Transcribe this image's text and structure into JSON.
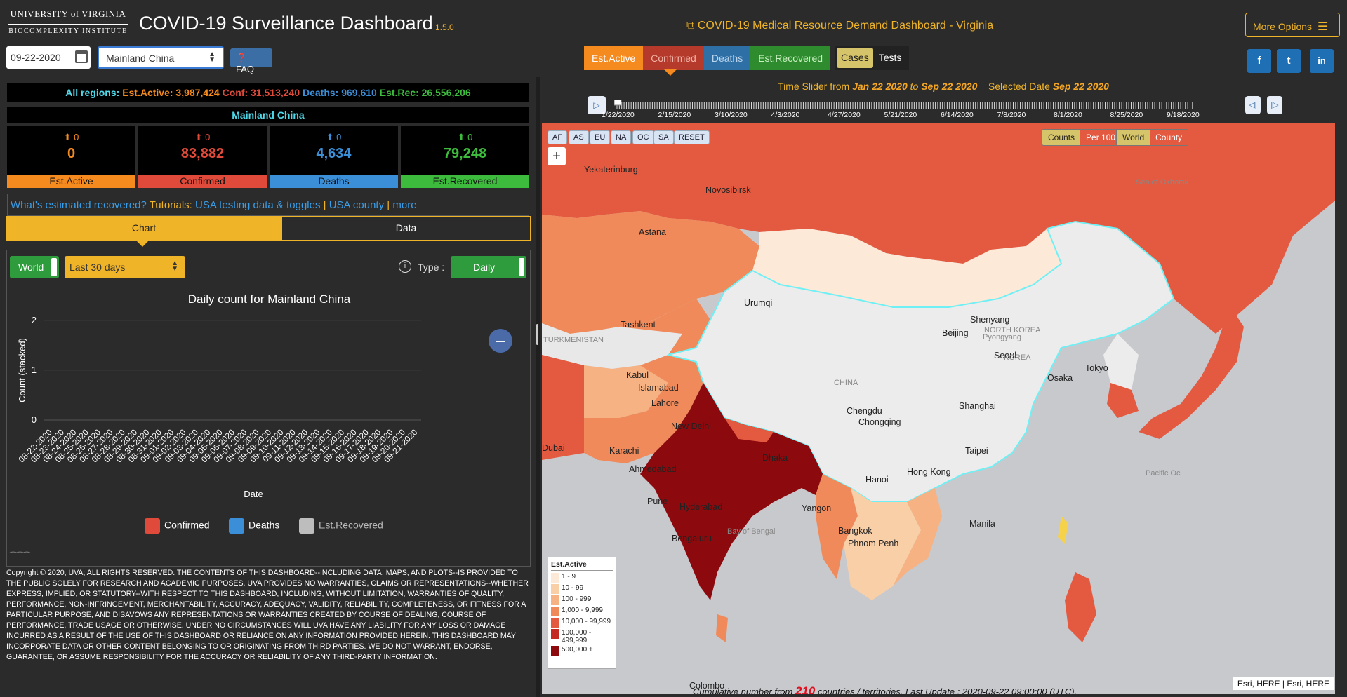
{
  "header": {
    "logo_uva": "UNIVERSITY of VIRGINIA",
    "logo_bio": "BIOCOMPLEXITY INSTITUTE",
    "title": "COVID-19 Surveillance Dashboard",
    "version": "1.5.0",
    "date_value": "09-22-2020",
    "region_value": "Mainland China",
    "faq_label": "FAQ",
    "medical_link": "COVID-19 Medical Resource Demand Dashboard - Virginia",
    "more_options": "More Options",
    "social": [
      "f",
      "t",
      "in"
    ]
  },
  "metric_tabs": [
    {
      "label": "Est.Active",
      "color": "#f58a1f"
    },
    {
      "label": "Confirmed",
      "color": "#b53a2c"
    },
    {
      "label": "Deaths",
      "color": "#2e6fa5"
    },
    {
      "label": "Est.Recovered",
      "color": "#2e8c2e"
    },
    {
      "label": "Cases",
      "color": "#d6c46a"
    },
    {
      "label": "Tests",
      "color": "#222"
    }
  ],
  "summary": {
    "prefix": "All regions:",
    "est_active": "Est.Active: 3,987,424",
    "conf": "Conf: 31,513,240",
    "deaths": "Deaths: 969,610",
    "est_rec": "Est.Rec: 26,556,206"
  },
  "region_head": "Mainland China",
  "stats": [
    {
      "change": "0",
      "value": "0",
      "label": "Est.Active",
      "color": "#f58a1f",
      "bg": "#f58a1f"
    },
    {
      "change": "0",
      "value": "83,882",
      "label": "Confirmed",
      "color": "#e04a3a",
      "bg": "#e04a3a"
    },
    {
      "change": "0",
      "value": "4,634",
      "label": "Deaths",
      "color": "#3a8fd8",
      "bg": "#3a8fd8"
    },
    {
      "change": "0",
      "value": "79,248",
      "label": "Est.Recovered",
      "color": "#3dbb3d",
      "bg": "#3dbb3d"
    }
  ],
  "links": {
    "q": "What's estimated recovered?",
    "tut": "Tutorials:",
    "l1": "USA testing data & toggles",
    "l2": "USA county",
    "l3": "more",
    "sep": "|"
  },
  "view_tabs": {
    "chart": "Chart",
    "data": "Data"
  },
  "chart_controls": {
    "scope": "World",
    "period": "Last 30 days",
    "type_label": "Type :",
    "type_value": "Daily"
  },
  "chart_data": {
    "type": "bar",
    "title": "Daily count for Mainland China",
    "xlabel": "Date",
    "ylabel": "Count (stacked)",
    "ylim": [
      0,
      2
    ],
    "yticks": [
      "2",
      "1",
      "0"
    ],
    "categories": [
      "08-22-2020",
      "08-23-2020",
      "08-24-2020",
      "08-25-2020",
      "08-26-2020",
      "08-27-2020",
      "08-28-2020",
      "08-29-2020",
      "08-30-2020",
      "08-31-2020",
      "09-01-2020",
      "09-02-2020",
      "09-03-2020",
      "09-04-2020",
      "09-05-2020",
      "09-06-2020",
      "09-07-2020",
      "09-08-2020",
      "09-09-2020",
      "09-10-2020",
      "09-11-2020",
      "09-12-2020",
      "09-13-2020",
      "09-14-2020",
      "09-15-2020",
      "09-16-2020",
      "09-17-2020",
      "09-18-2020",
      "09-19-2020",
      "09-20-2020",
      "09-21-2020"
    ],
    "series": [
      {
        "name": "Confirmed",
        "color": "#e04a3a",
        "values": [
          0,
          0,
          0,
          0,
          0,
          0,
          0,
          0,
          0,
          0,
          0,
          0,
          0,
          0,
          0,
          0,
          0,
          0,
          0,
          0,
          0,
          0,
          0,
          0,
          0,
          0,
          0,
          0,
          0,
          0,
          0
        ]
      },
      {
        "name": "Deaths",
        "color": "#3a8fd8",
        "values": [
          0,
          0,
          0,
          0,
          0,
          0,
          0,
          0,
          0,
          0,
          0,
          0,
          0,
          0,
          0,
          0,
          0,
          0,
          0,
          0,
          0,
          0,
          0,
          0,
          0,
          0,
          0,
          0,
          0,
          0,
          0
        ]
      },
      {
        "name": "Est.Recovered",
        "color": "#bdbdbd",
        "values": [
          0,
          0,
          0,
          0,
          0,
          0,
          0,
          0,
          0,
          0,
          0,
          0,
          0,
          0,
          0,
          0,
          0,
          0,
          0,
          0,
          0,
          0,
          0,
          0,
          0,
          0,
          0,
          0,
          0,
          0,
          0
        ]
      }
    ],
    "legend": "bottom"
  },
  "copyright": "Copyright © 2020, UVA; ALL RIGHTS RESERVED. THE CONTENTS OF THIS DASHBOARD--INCLUDING DATA, MAPS, AND PLOTS--IS PROVIDED TO THE PUBLIC SOLELY FOR RESEARCH AND ACADEMIC PURPOSES. UVA PROVIDES NO WARRANTIES, CLAIMS OR REPRESENTATIONS--WHETHER EXPRESS, IMPLIED, OR STATUTORY--WITH RESPECT TO THIS DASHBOARD, INCLUDING, WITHOUT LIMITATION, WARRANTIES OF QUALITY, PERFORMANCE, NON-INFRINGEMENT, MERCHANTABILITY, ACCURACY, ADEQUACY, VALIDITY, RELIABILITY, COMPLETENESS, OR FITNESS FOR A PARTICULAR PURPOSE, AND DISAVOWS ANY REPRESENTATIONS OR WARRANTIES CREATED BY COURSE OF DEALING, COURSE OF PERFORMANCE, TRADE USAGE OR OTHERWISE. UNDER NO CIRCUMSTANCES WILL UVA HAVE ANY LIABILITY FOR ANY LOSS OR DAMAGE INCURRED AS A RESULT OF THE USE OF THIS DASHBOARD OR RELIANCE ON ANY INFORMATION PROVIDED HEREIN. THIS DASHBOARD MAY INCORPORATE DATA OR OTHER CONTENT BELONGING TO OR ORIGINATING FROM THIRD PARTIES. WE DO NOT WARRANT, ENDORSE, GUARANTEE, OR ASSUME RESPONSIBILITY FOR THE ACCURACY OR RELIABILITY OF ANY THIRD-PARTY INFORMATION.",
  "slider": {
    "prefix": "Time Slider from",
    "from": "Jan 22 2020",
    "to_word": "to",
    "to": "Sep 22 2020",
    "sel_prefix": "Selected Date",
    "sel": "Sep 22 2020",
    "ticks": [
      "1/22/2020",
      "2/15/2020",
      "3/10/2020",
      "4/3/2020",
      "4/27/2020",
      "5/21/2020",
      "6/14/2020",
      "7/8/2020",
      "8/1/2020",
      "8/25/2020",
      "9/18/2020"
    ]
  },
  "map": {
    "region_buttons": [
      "AF",
      "AS",
      "EU",
      "NA",
      "OC",
      "SA",
      "RESET"
    ],
    "counts_toggle": [
      "Counts",
      "Per 100K"
    ],
    "world_toggle": [
      "World",
      "County"
    ],
    "legend_title": "Est.Active",
    "legend_rows": [
      {
        "label": "1 - 9",
        "color": "#fde9d8"
      },
      {
        "label": "10 - 99",
        "color": "#f9cfa8"
      },
      {
        "label": "100 - 999",
        "color": "#f6b283"
      },
      {
        "label": "1,000 - 9,999",
        "color": "#f08a5a"
      },
      {
        "label": "10,000 - 99,999",
        "color": "#e45a40"
      },
      {
        "label": "100,000 - 499,999",
        "color": "#c42a22"
      },
      {
        "label": "500,000 +",
        "color": "#8c0a0e"
      }
    ],
    "cumulative_prefix": "Cumulative number from",
    "cumulative_count": "210",
    "cumulative_suffix": "countries / territories. Last Update : 2020-09-22 09:00:00 (UTC).",
    "attribution": "Esri, HERE | Esri, HERE",
    "cities": [
      {
        "name": "Yekaterinburg"
      },
      {
        "name": "Novosibirsk"
      },
      {
        "name": "Astana"
      },
      {
        "name": "Urumqi"
      },
      {
        "name": "Tashkent"
      },
      {
        "name": "TURKMENISTAN"
      },
      {
        "name": "Kabul"
      },
      {
        "name": "Islamabad"
      },
      {
        "name": "Lahore"
      },
      {
        "name": "New Delhi"
      },
      {
        "name": "Karachi"
      },
      {
        "name": "Ahmedabad"
      },
      {
        "name": "Pune"
      },
      {
        "name": "Hyderabad"
      },
      {
        "name": "Bengaluru"
      },
      {
        "name": "Dhaka"
      },
      {
        "name": "Yangon"
      },
      {
        "name": "Bangkok"
      },
      {
        "name": "Phnom Penh"
      },
      {
        "name": "Hanoi"
      },
      {
        "name": "Hong Kong"
      },
      {
        "name": "Taipei"
      },
      {
        "name": "Manila"
      },
      {
        "name": "Shanghai"
      },
      {
        "name": "Chengdu"
      },
      {
        "name": "Chongqing"
      },
      {
        "name": "Beijing"
      },
      {
        "name": "Shenyang"
      },
      {
        "name": "Pyongyang"
      },
      {
        "name": "Seoul"
      },
      {
        "name": "Osaka"
      },
      {
        "name": "Tokyo"
      },
      {
        "name": "CHINA"
      },
      {
        "name": "NORTH KOREA"
      },
      {
        "name": "KOREA"
      },
      {
        "name": "Sea of Okhotsk"
      },
      {
        "name": "Pacific Oc"
      },
      {
        "name": "Bay of Bengal"
      },
      {
        "name": "Dubai"
      },
      {
        "name": "Colombo"
      }
    ]
  }
}
